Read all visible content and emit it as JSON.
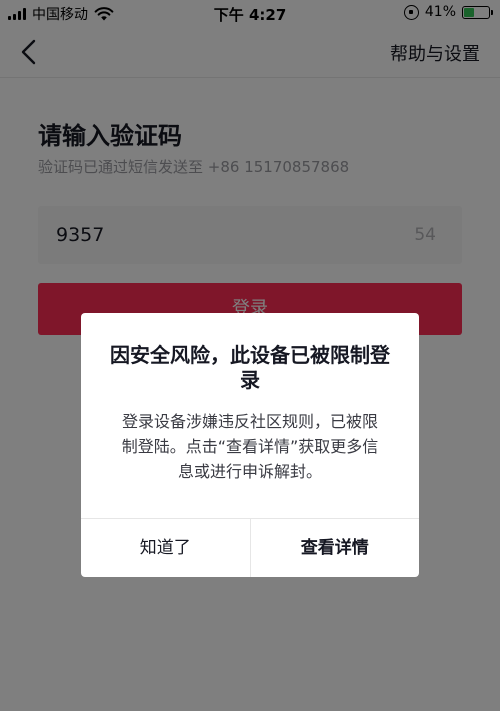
{
  "status_bar": {
    "carrier": "中国移动",
    "time": "下午 4:27",
    "battery_percent": "41%",
    "battery_level": 0.41,
    "icons": [
      "signal-icon",
      "wifi-icon",
      "rotation-lock-icon",
      "battery-charging-icon"
    ]
  },
  "nav": {
    "back_icon": "chevron-left-icon",
    "help_label": "帮助与设置"
  },
  "form": {
    "title": "请输入验证码",
    "subtitle": "验证码已通过短信发送至 +86 15170857868",
    "code_value": "9357",
    "countdown": "54",
    "login_label": "登录"
  },
  "dialog": {
    "title": "因安全风险，此设备已被限制登录",
    "message": "登录设备涉嫌违反社区规则，已被限制登陆。点击“查看详情”获取更多信息或进行申诉解封。",
    "cancel_label": "知道了",
    "confirm_label": "查看详情"
  },
  "colors": {
    "accent": "#fe2c55",
    "overlay": "rgba(0,0,0,0.5)",
    "battery_fill": "#35c759"
  }
}
